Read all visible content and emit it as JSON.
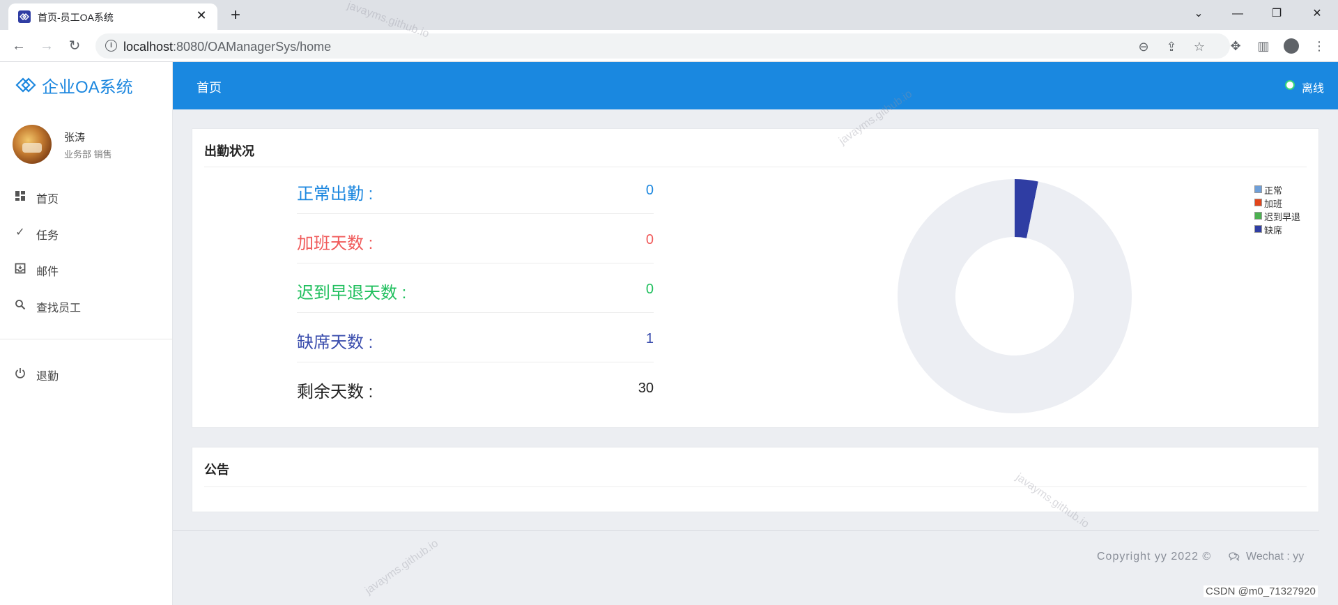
{
  "browser": {
    "tab_title": "首页-员工OA系统",
    "url_host": "localhost",
    "url_path": ":8080/OAManagerSys/home"
  },
  "sidebar": {
    "brand": "企业OA系统",
    "user": {
      "name": "张涛",
      "dept": "业务部 销售"
    },
    "items": [
      {
        "label": "首页",
        "icon": "dashboard-icon"
      },
      {
        "label": "任务",
        "icon": "check-icon"
      },
      {
        "label": "邮件",
        "icon": "inbox-icon"
      },
      {
        "label": "查找员工",
        "icon": "search-icon"
      },
      {
        "label": "退勤",
        "icon": "power-icon"
      }
    ]
  },
  "header": {
    "title": "首页",
    "status": "离线",
    "status_color": "#3ad67a",
    "bar_color": "#1a88e0"
  },
  "attendance": {
    "title": "出勤状况",
    "rows": [
      {
        "label": "正常出勤 :",
        "value": "0",
        "color": "#1c87df"
      },
      {
        "label": "加班天数 :",
        "value": "0",
        "color": "#f05a5a"
      },
      {
        "label": "迟到早退天数 :",
        "value": "0",
        "color": "#1fbf5d"
      },
      {
        "label": "缺席天数 :",
        "value": "1",
        "color": "#3a4dad"
      },
      {
        "label": "剩余天数 :",
        "value": "30",
        "color": "#222222"
      }
    ]
  },
  "chart_data": {
    "type": "pie",
    "donut": true,
    "legend_position": "top-right",
    "series": [
      {
        "name": "正常",
        "value": 0,
        "color": "#6f9fd8"
      },
      {
        "name": "加班",
        "value": 0,
        "color": "#e2451b"
      },
      {
        "name": "迟到早退",
        "value": 0,
        "color": "#4cb050"
      },
      {
        "name": "缺席",
        "value": 1,
        "color": "#2f3da3"
      }
    ],
    "remainder": {
      "value": 30,
      "color": "#eceef3"
    }
  },
  "notice": {
    "title": "公告"
  },
  "footer": {
    "copyright": "Copyright yy 2022 ©",
    "wechat": "Wechat : yy",
    "csdn": "CSDN @m0_71327920"
  },
  "watermark": "javayms.github.io"
}
